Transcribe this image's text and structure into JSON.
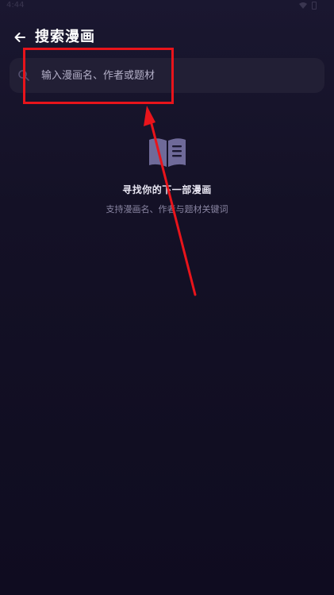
{
  "status_bar": {
    "time": "4:44"
  },
  "header": {
    "title": "搜索漫画"
  },
  "search": {
    "placeholder": "输入漫画名、作者或题材",
    "value": ""
  },
  "empty_state": {
    "title": "寻找你的下一部漫画",
    "subtitle": "支持漫画名、作者与题材关键词"
  },
  "icons": {
    "back": "arrow-left-icon",
    "search": "search-icon",
    "empty": "open-book-icon"
  },
  "colors": {
    "background_top": "#1a1730",
    "background_bottom": "#0f0c20",
    "search_bg": "#221f35",
    "icon_tint": "#6f6a99",
    "annotation": "#e8141b"
  }
}
